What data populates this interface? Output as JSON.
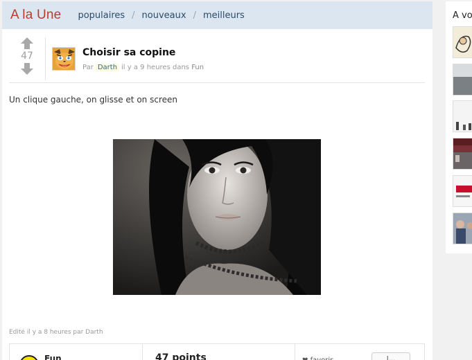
{
  "header": {
    "title": "A la Une",
    "tabs": [
      {
        "label": "populaires"
      },
      {
        "label": "nouveaux"
      },
      {
        "label": "meilleurs"
      }
    ],
    "separator": "/"
  },
  "post": {
    "votes": "47",
    "title": "Choisir sa copine",
    "meta_prefix": "Par",
    "author": "Darth",
    "meta_time": "il y a 9 heures dans",
    "category": "Fun",
    "body": "Un clique gauche, on glisse et on screen",
    "edited": "Edité il y a 8 heures par Darth"
  },
  "footer": {
    "category": "Fun",
    "points": "47 points",
    "favorite": "favoris",
    "like": "J..."
  },
  "sidebar": {
    "title": "A vo"
  },
  "colors": {
    "accent": "#c0392b",
    "tabbar": "#dbe6f0",
    "link": "#2a4a6b"
  }
}
